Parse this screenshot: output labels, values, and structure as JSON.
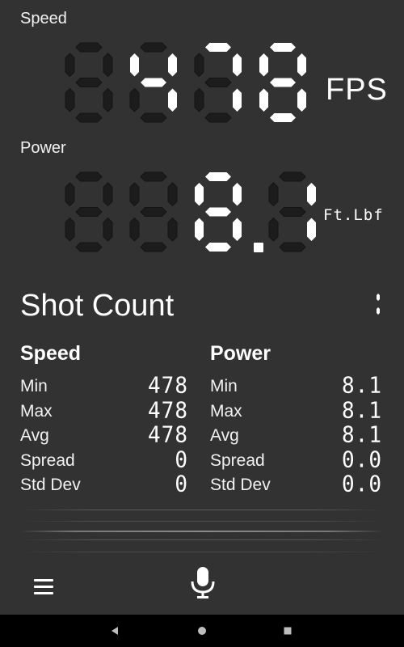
{
  "speed": {
    "label": "Speed",
    "digits": [
      "8",
      "4",
      "7",
      "8"
    ],
    "active": [
      false,
      true,
      true,
      true
    ],
    "unit": "FPS"
  },
  "power": {
    "label": "Power",
    "digits": [
      "8",
      "8",
      "8",
      "1"
    ],
    "active": [
      false,
      false,
      true,
      true
    ],
    "decimal_after": 2,
    "unit": "Ft.Lbf"
  },
  "shot_count": {
    "label": "Shot Count",
    "value": "1"
  },
  "stats": {
    "speed": {
      "title": "Speed",
      "rows": [
        {
          "label": "Min",
          "value": "478"
        },
        {
          "label": "Max",
          "value": "478"
        },
        {
          "label": "Avg",
          "value": "478"
        },
        {
          "label": "Spread",
          "value": "0"
        },
        {
          "label": "Std Dev",
          "value": "0"
        }
      ]
    },
    "power": {
      "title": "Power",
      "rows": [
        {
          "label": "Min",
          "value": "8.1"
        },
        {
          "label": "Max",
          "value": "8.1"
        },
        {
          "label": "Avg",
          "value": "8.1"
        },
        {
          "label": "Spread",
          "value": "0.0"
        },
        {
          "label": "Std Dev",
          "value": "0.0"
        }
      ]
    }
  },
  "icons": {
    "menu": "menu-icon",
    "mic": "microphone-icon",
    "back": "back-icon",
    "home": "home-icon",
    "recents": "recents-icon"
  },
  "colors": {
    "background": "#323232",
    "segment_on": "#ffffff",
    "segment_off": "#1c1c1c",
    "segment_off_stroke": "#141414",
    "nav_bar": "#000000"
  }
}
